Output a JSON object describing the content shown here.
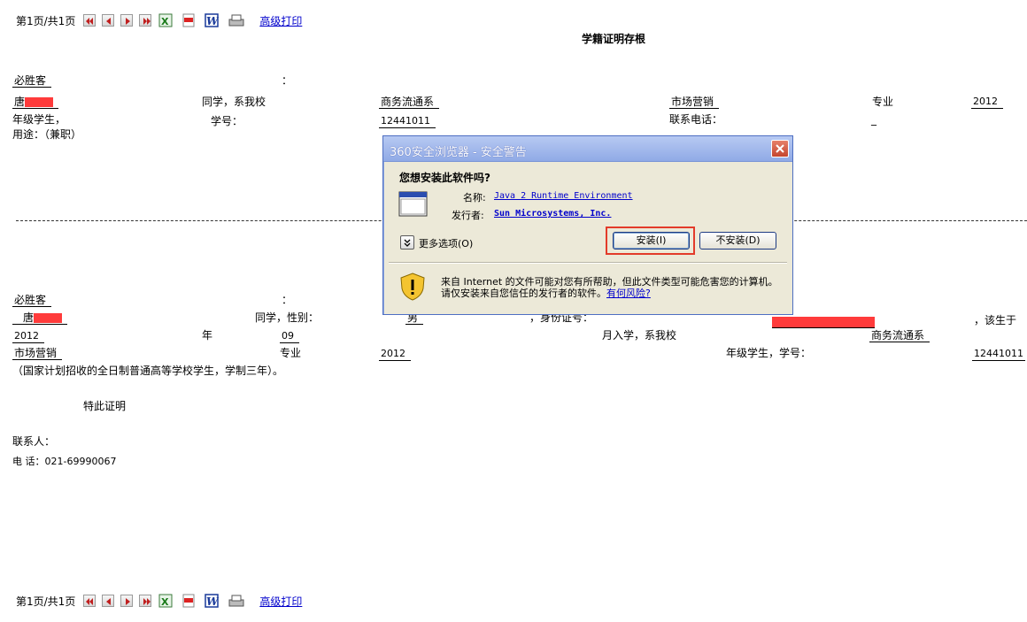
{
  "toolbar": {
    "page_info": "第1页/共1页",
    "advanced_print": "高级打印",
    "icons": [
      "first-page-icon",
      "prev-page-icon",
      "next-page-icon",
      "last-page-icon",
      "excel-icon",
      "pdf-icon",
      "word-icon",
      "print-icon"
    ]
  },
  "doc_title": "学籍证明存根",
  "stub": {
    "company": "必胜客",
    "colon": "：",
    "name_prefix": "唐",
    "classmate_school": "同学，系我校",
    "dept": "商务流通系",
    "major": "市场营销",
    "major_label": "专业",
    "year": "2012",
    "grade_student": "年级学生，",
    "student_no_label": "学号：",
    "student_no": "12441011",
    "phone_label": "联系电话：",
    "phone_val": "_",
    "purpose": "用途：（兼职）"
  },
  "cert": {
    "company": "必胜客",
    "colon": "：",
    "name_prefix": "唐",
    "classmate_gender": "同学，性别：",
    "gender": "男",
    "id_label": "，身份证号：",
    "born_at": "，该生于",
    "year": "2012",
    "year_label": "年",
    "month": "09",
    "enroll": "月入学，系我校",
    "dept": "商务流通系",
    "major": "市场营销",
    "major_label": "专业",
    "grade_year": "2012",
    "grade_student_no": "年级学生，学号：",
    "student_no": "12441011",
    "note": "（国家计划招收的全日制普通高等学校学生，学制三年）。",
    "certify": "特此证明",
    "contact": "联系人：",
    "tel": "电 话：021-69990067"
  },
  "dialog": {
    "title": "360安全浏览器 - 安全警告",
    "question": "您想安装此软件吗?",
    "name_label": "名称:",
    "name_value": "Java 2 Runtime Environment",
    "publisher_label": "发行者:",
    "publisher_value": "Sun Microsystems, Inc.",
    "more_options": "更多选项(O)",
    "install": "安装(I)",
    "dont_install": "不安装(D)",
    "warning": "来自 Internet 的文件可能对您有所帮助，但此文件类型可能危害您的计算机。请仅安装来自您信任的发行者的软件。",
    "risk_link": "有何风险?"
  },
  "colors": {
    "redaction": "#ff3b3b",
    "highlight": "#e33b2a",
    "link": "#0000cc"
  }
}
